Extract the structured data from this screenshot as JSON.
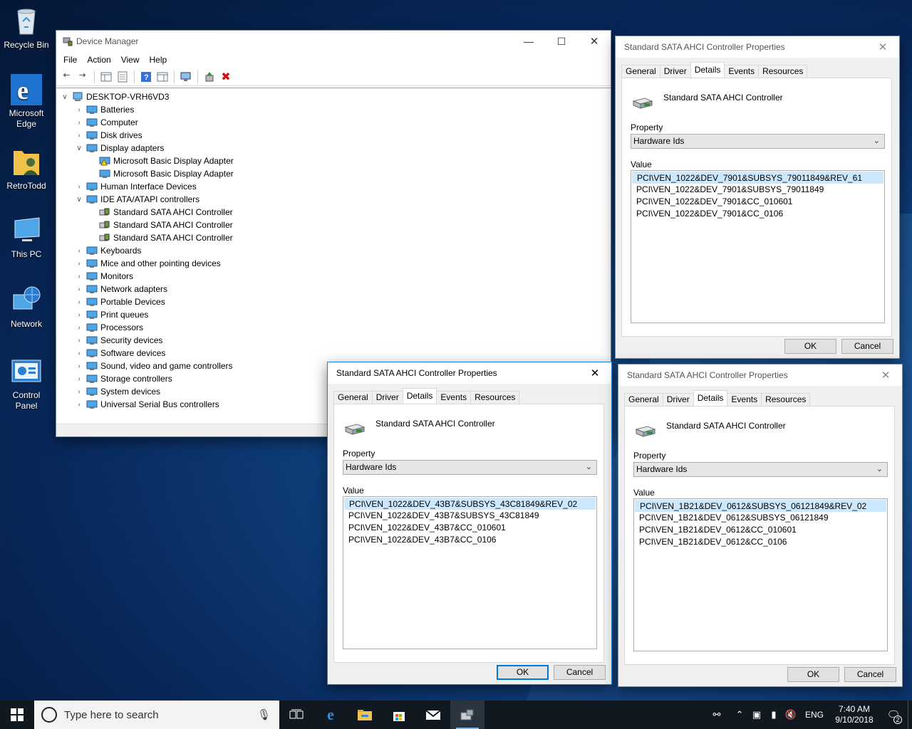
{
  "desktop": {
    "icons": [
      {
        "label": "Recycle Bin",
        "icon": "recycle-bin-icon"
      },
      {
        "label": "Microsoft Edge",
        "icon": "edge-icon"
      },
      {
        "label": "RetroTodd",
        "icon": "user-folder-icon"
      },
      {
        "label": "This PC",
        "icon": "computer-icon"
      },
      {
        "label": "Network",
        "icon": "network-icon"
      },
      {
        "label": "Control Panel",
        "icon": "control-panel-icon"
      }
    ]
  },
  "device_manager": {
    "title": "Device Manager",
    "menu": [
      "File",
      "Action",
      "View",
      "Help"
    ],
    "root": "DESKTOP-VRH6VD3",
    "tree": [
      {
        "label": "Batteries",
        "level": 1,
        "state": "collapsed"
      },
      {
        "label": "Computer",
        "level": 1,
        "state": "collapsed"
      },
      {
        "label": "Disk drives",
        "level": 1,
        "state": "collapsed"
      },
      {
        "label": "Display adapters",
        "level": 1,
        "state": "expanded"
      },
      {
        "label": "Microsoft Basic Display Adapter",
        "level": 2,
        "state": "leaf",
        "warning": true
      },
      {
        "label": "Microsoft Basic Display Adapter",
        "level": 2,
        "state": "leaf"
      },
      {
        "label": "Human Interface Devices",
        "level": 1,
        "state": "collapsed"
      },
      {
        "label": "IDE ATA/ATAPI controllers",
        "level": 1,
        "state": "expanded"
      },
      {
        "label": "Standard SATA AHCI Controller",
        "level": 2,
        "state": "leaf"
      },
      {
        "label": "Standard SATA AHCI Controller",
        "level": 2,
        "state": "leaf"
      },
      {
        "label": "Standard SATA AHCI Controller",
        "level": 2,
        "state": "leaf"
      },
      {
        "label": "Keyboards",
        "level": 1,
        "state": "collapsed"
      },
      {
        "label": "Mice and other pointing devices",
        "level": 1,
        "state": "collapsed"
      },
      {
        "label": "Monitors",
        "level": 1,
        "state": "collapsed"
      },
      {
        "label": "Network adapters",
        "level": 1,
        "state": "collapsed"
      },
      {
        "label": "Portable Devices",
        "level": 1,
        "state": "collapsed"
      },
      {
        "label": "Print queues",
        "level": 1,
        "state": "collapsed"
      },
      {
        "label": "Processors",
        "level": 1,
        "state": "collapsed"
      },
      {
        "label": "Security devices",
        "level": 1,
        "state": "collapsed"
      },
      {
        "label": "Software devices",
        "level": 1,
        "state": "collapsed"
      },
      {
        "label": "Sound, video and game controllers",
        "level": 1,
        "state": "collapsed"
      },
      {
        "label": "Storage controllers",
        "level": 1,
        "state": "collapsed"
      },
      {
        "label": "System devices",
        "level": 1,
        "state": "collapsed"
      },
      {
        "label": "Universal Serial Bus controllers",
        "level": 1,
        "state": "collapsed"
      }
    ]
  },
  "dialogs": [
    {
      "title": "Standard SATA AHCI Controller Properties",
      "active": false,
      "tabs": [
        "General",
        "Driver",
        "Details",
        "Events",
        "Resources"
      ],
      "selected_tab": "Details",
      "device_name": "Standard SATA AHCI Controller",
      "property_label": "Property",
      "property_value": "Hardware Ids",
      "value_label": "Value",
      "values": [
        "PCI\\VEN_1022&DEV_7901&SUBSYS_79011849&REV_61",
        "PCI\\VEN_1022&DEV_7901&SUBSYS_79011849",
        "PCI\\VEN_1022&DEV_7901&CC_010601",
        "PCI\\VEN_1022&DEV_7901&CC_0106"
      ],
      "ok_label": "OK",
      "cancel_label": "Cancel"
    },
    {
      "title": "Standard SATA AHCI Controller Properties",
      "active": true,
      "tabs": [
        "General",
        "Driver",
        "Details",
        "Events",
        "Resources"
      ],
      "selected_tab": "Details",
      "device_name": "Standard SATA AHCI Controller",
      "property_label": "Property",
      "property_value": "Hardware Ids",
      "value_label": "Value",
      "values": [
        "PCI\\VEN_1022&DEV_43B7&SUBSYS_43C81849&REV_02",
        "PCI\\VEN_1022&DEV_43B7&SUBSYS_43C81849",
        "PCI\\VEN_1022&DEV_43B7&CC_010601",
        "PCI\\VEN_1022&DEV_43B7&CC_0106"
      ],
      "ok_label": "OK",
      "cancel_label": "Cancel"
    },
    {
      "title": "Standard SATA AHCI Controller Properties",
      "active": false,
      "tabs": [
        "General",
        "Driver",
        "Details",
        "Events",
        "Resources"
      ],
      "selected_tab": "Details",
      "device_name": "Standard SATA AHCI Controller",
      "property_label": "Property",
      "property_value": "Hardware Ids",
      "value_label": "Value",
      "values": [
        "PCI\\VEN_1B21&DEV_0612&SUBSYS_06121849&REV_02",
        "PCI\\VEN_1B21&DEV_0612&SUBSYS_06121849",
        "PCI\\VEN_1B21&DEV_0612&CC_010601",
        "PCI\\VEN_1B21&DEV_0612&CC_0106"
      ],
      "ok_label": "OK",
      "cancel_label": "Cancel"
    }
  ],
  "taskbar": {
    "search_placeholder": "Type here to search",
    "apps": [
      "task-view-icon",
      "edge-icon",
      "file-explorer-icon",
      "store-icon",
      "mail-icon",
      "device-manager-icon"
    ],
    "language": "ENG",
    "time": "7:40 AM",
    "date": "9/10/2018",
    "notification_count": "2"
  },
  "colors": {
    "accent": "#0078d7",
    "selection": "#cce8ff",
    "taskbar": "#101820"
  }
}
